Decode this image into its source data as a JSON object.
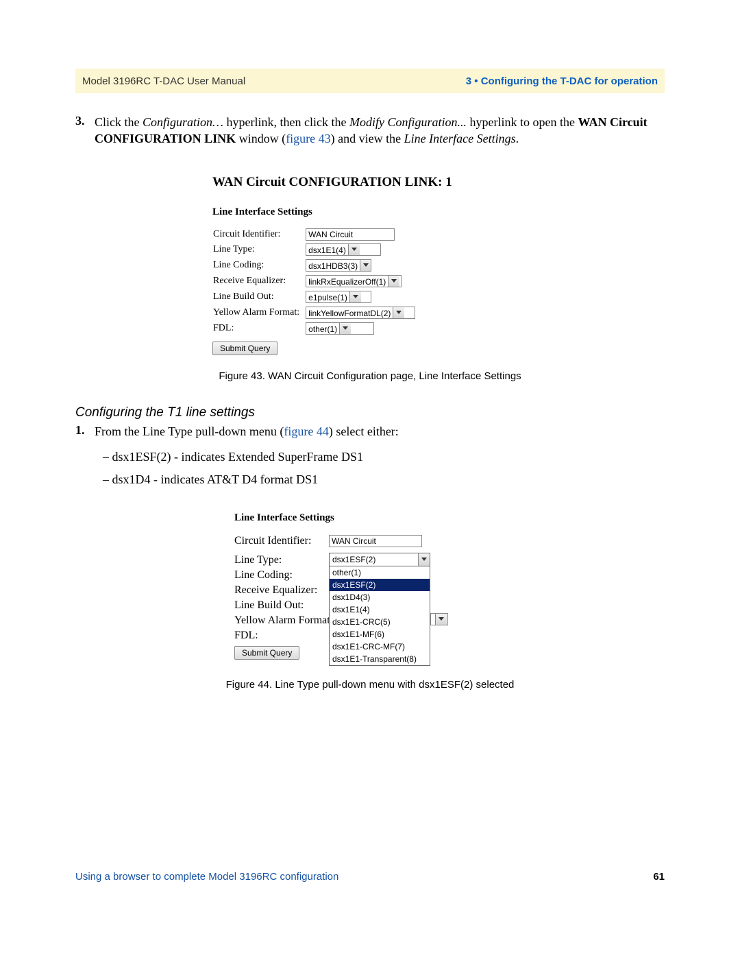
{
  "header": {
    "left": "Model 3196RC T-DAC User Manual",
    "right": "3 • Configuring the T-DAC for operation"
  },
  "step3": {
    "number": "3.",
    "text_prefix": "Click the ",
    "link1": "Configuration…",
    "text_mid1": " hyperlink, then click the ",
    "link2": "Modify Configuration...",
    "text_mid2": " hyperlink to open the ",
    "bold1": "WAN Circuit CONFIGURATION LINK",
    "text_mid3": " window (",
    "figref": "figure 43",
    "text_mid4": ") and view the ",
    "italic1": "Line Interface Settings",
    "text_end": "."
  },
  "figure43": {
    "title": "WAN Circuit CONFIGURATION LINK: 1",
    "lis_heading": "Line Interface Settings",
    "rows": {
      "circuit_identifier_label": "Circuit Identifier:",
      "circuit_identifier_value": "WAN Circuit",
      "line_type_label": "Line Type:",
      "line_type_value": "dsx1E1(4)",
      "line_coding_label": "Line Coding:",
      "line_coding_value": "dsx1HDB3(3)",
      "receive_eq_label": "Receive Equalizer:",
      "receive_eq_value": "linkRxEqualizerOff(1)",
      "line_build_out_label": "Line Build Out:",
      "line_build_out_value": "e1pulse(1)",
      "yellow_alarm_label": "Yellow Alarm Format:",
      "yellow_alarm_value": "linkYellowFormatDL(2)",
      "fdl_label": "FDL:",
      "fdl_value": "other(1)"
    },
    "submit": "Submit Query",
    "caption": "Figure 43. WAN Circuit Configuration page, Line Interface Settings"
  },
  "t1_section": {
    "heading": "Configuring the T1 line settings",
    "step1": {
      "number": "1.",
      "text_prefix": "From the ",
      "italic1": "Line Type",
      "text_mid1": " pull-down menu (",
      "figref": "figure 44",
      "text_mid2": ") select either:"
    },
    "dash1_prefix": "– ",
    "dash1_italic": "dsx1ESF(2)",
    "dash1_rest": " - indicates Extended SuperFrame DS1",
    "dash2_prefix": "– ",
    "dash2_italic": "dsx1D4",
    "dash2_rest": " - indicates AT&T D4 format DS1"
  },
  "figure44": {
    "lis_heading": "Line Interface Settings",
    "labels": {
      "circuit_identifier": "Circuit Identifier:",
      "line_type": "Line Type:",
      "line_coding": "Line Coding:",
      "receive_eq": "Receive Equalizer:",
      "line_build_out": "Line Build Out:",
      "yellow_alarm": "Yellow Alarm Format:",
      "fdl": "FDL:"
    },
    "circuit_identifier_value": "WAN Circuit",
    "line_type_selected": "dsx1ESF(2)",
    "line_type_options": [
      "other(1)",
      "dsx1ESF(2)",
      "dsx1D4(3)",
      "dsx1E1(4)",
      "dsx1E1-CRC(5)",
      "dsx1E1-MF(6)",
      "dsx1E1-CRC-MF(7)",
      "dsx1E1-Transparent(8)"
    ],
    "line_type_highlight_index": 1,
    "submit": "Submit Query",
    "caption": "Figure 44. Line Type pull-down menu with dsx1ESF(2) selected"
  },
  "footer": {
    "left": "Using a browser to complete Model 3196RC configuration",
    "right": "61"
  }
}
